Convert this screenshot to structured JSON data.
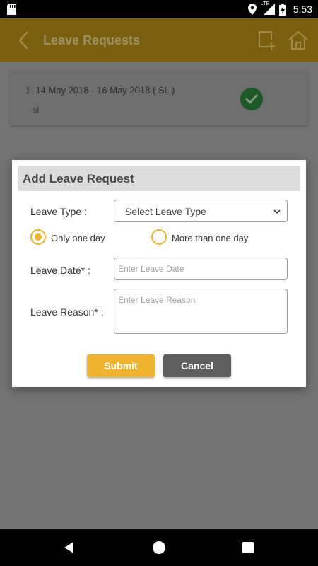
{
  "status_bar": {
    "time": "5:53",
    "network": "LTE",
    "icons": [
      "sd-card-icon",
      "location-icon",
      "signal-icon",
      "battery-charging-icon"
    ]
  },
  "app_bar": {
    "title": "Leave Requests",
    "icons": [
      "back-arrow-icon",
      "add-note-icon",
      "home-icon"
    ]
  },
  "leave_list": [
    {
      "dates": "1.  14 May 2018  -  16 May 2018 ( SL )",
      "reason": "sl",
      "status_icon": "check-circle-icon"
    }
  ],
  "dialog": {
    "title": "Add Leave Request",
    "leave_type": {
      "label": "Leave Type :",
      "selected": "Select Leave Type"
    },
    "duration": {
      "options": [
        {
          "label": "Only one day",
          "checked": true
        },
        {
          "label": "More than one day",
          "checked": false
        }
      ]
    },
    "leave_date": {
      "label": "Leave Date* :",
      "placeholder": "Enter Leave Date",
      "value": ""
    },
    "leave_reason": {
      "label": "Leave Reason* :",
      "placeholder": "Enter Leave Reason",
      "value": ""
    },
    "buttons": {
      "submit": "Submit",
      "cancel": "Cancel"
    }
  },
  "colors": {
    "accent": "#f0b32e",
    "cancel": "#5e5e5e",
    "scrim_bg": "#737373"
  }
}
